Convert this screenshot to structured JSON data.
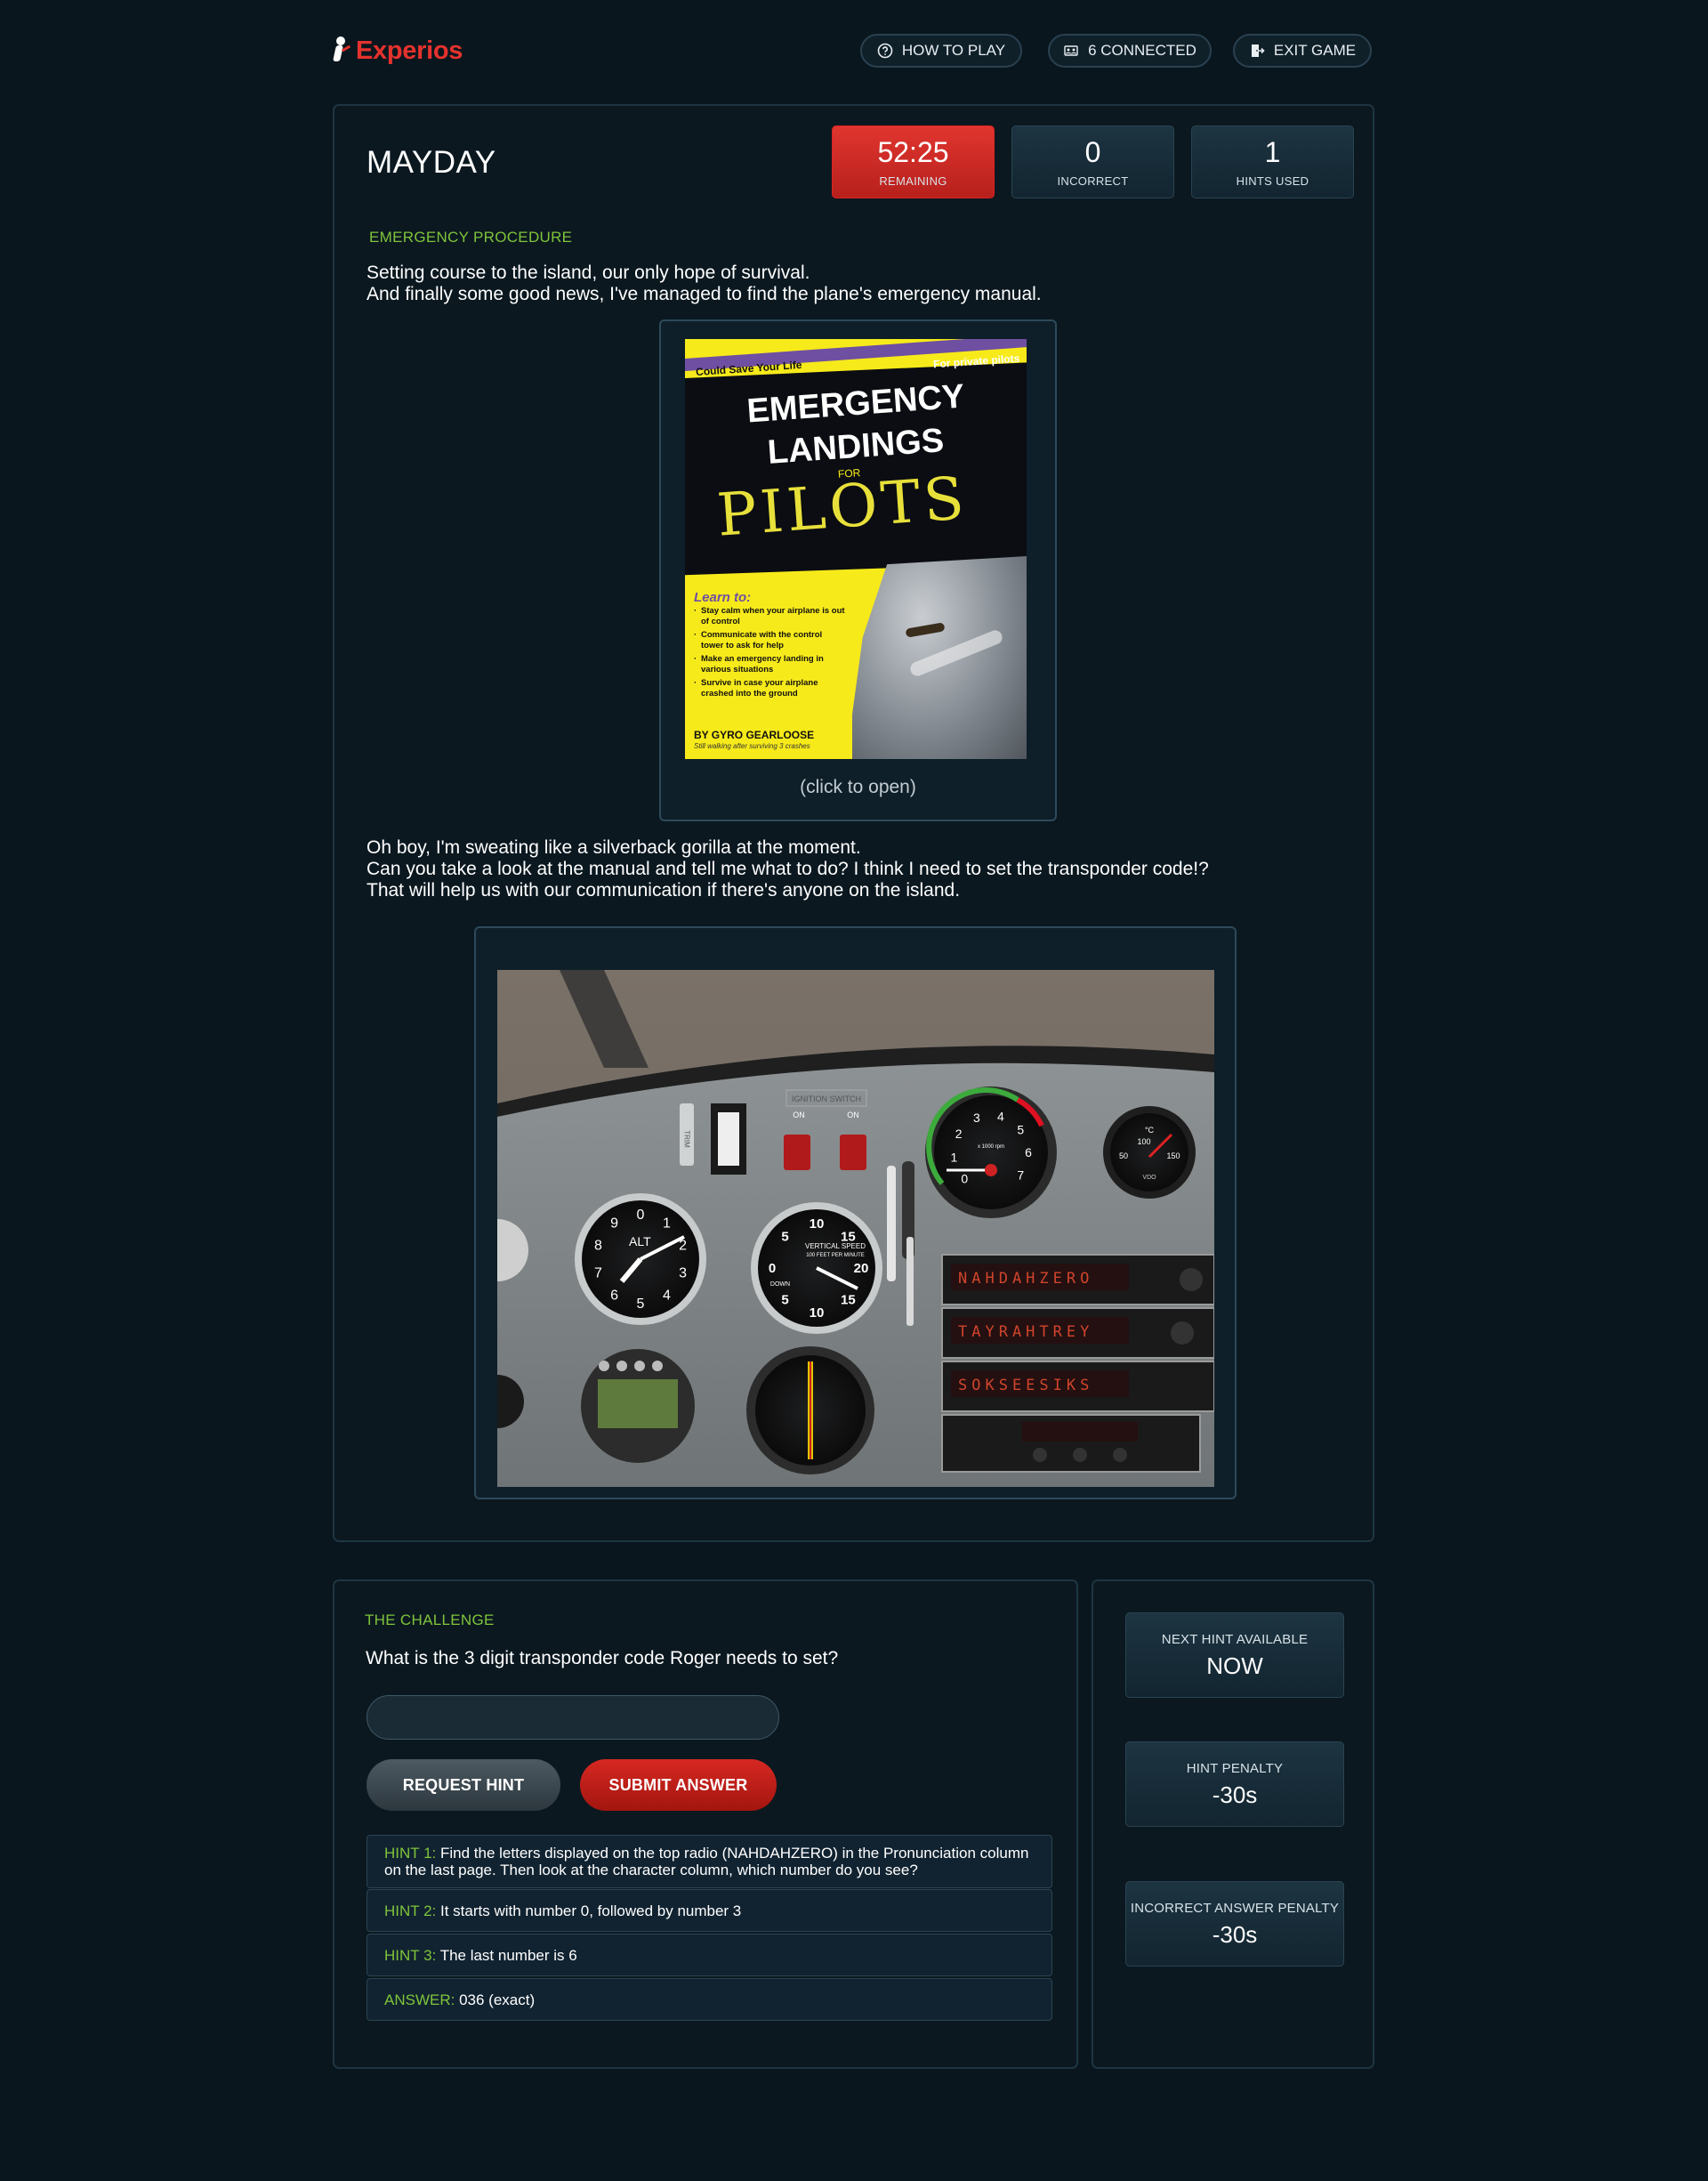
{
  "nav": {
    "brand": "Experios",
    "how_to_play": "HOW TO PLAY",
    "connected": "6 CONNECTED",
    "exit": "EXIT GAME"
  },
  "game": {
    "title": "MAYDAY",
    "stats": [
      {
        "value": "52:25",
        "label": "REMAINING"
      },
      {
        "value": "0",
        "label": "INCORRECT"
      },
      {
        "value": "1",
        "label": "HINTS USED"
      }
    ]
  },
  "story": {
    "section": "EMERGENCY PROCEDURE",
    "intro": [
      "Setting course to the island, our only hope of survival.",
      "And finally some good news, I've managed to find the plane's emergency manual."
    ],
    "click_to_open": "(click to open)",
    "body": [
      "Oh boy, I'm sweating like a silverback gorilla at the moment.",
      "Can you take a look at the manual and tell me what to do? I think I need to set the transponder code!?",
      "That will help us with our communication if there's anyone on the island."
    ]
  },
  "book": {
    "tagline": "Could Save Your Life",
    "audience": "For private pilots",
    "title_1": "EMERGENCY",
    "title_2": "LANDINGS",
    "for": "FOR",
    "title_3": "PILOTS",
    "learn": "Learn to:",
    "items": [
      "Stay calm when your airplane is out of control",
      "Communicate with the control tower to ask for help",
      "Make an emergency landing in various situations",
      "Survive in case your airplane crashed into the ground"
    ],
    "author": "BY GYRO GEARLOOSE",
    "author_note": "Still walking after surviving 3 crashes"
  },
  "cockpit": {
    "radio_1": "NAHDAHZERO",
    "radio_2": "TAYRAHTREY",
    "radio_3": "SOKSEESIKS",
    "ignition": "IGNITION SWITCH",
    "on_1": "ON",
    "on_2": "ON",
    "alt": "ALT",
    "vs_line1": "VERTICAL SPEED",
    "vs_line2": "100 FEET PER MINUTE",
    "vs_down": "DOWN",
    "rpm": "x 1000 rpm",
    "temp_unit": "°C",
    "oil_label": "VDO",
    "oil_left": "50",
    "oil_top": "100",
    "oil_right": "150",
    "trim": "TRIM",
    "alt_digits": [
      "0",
      "1",
      "2",
      "3",
      "4",
      "5",
      "6",
      "7",
      "8",
      "9"
    ],
    "vs_digits": [
      "0",
      "5",
      "10",
      "15",
      "20",
      "15",
      "10",
      "5"
    ],
    "rpm_digits": [
      "0",
      "1",
      "2",
      "3",
      "4",
      "5",
      "6",
      "7"
    ]
  },
  "challenge": {
    "section": "THE CHALLENGE",
    "question": "What is the 3 digit transponder code Roger needs to set?",
    "input_value": "",
    "input_placeholder": "",
    "request_hint": "REQUEST HINT",
    "submit": "SUBMIT ANSWER",
    "hints": [
      {
        "key": "HINT 1:",
        "text": "Find the letters displayed on the top radio (NAHDAHZERO) in the Pronunciation column on the last page. Then look at the character column, which number do you see?"
      },
      {
        "key": "HINT 2:",
        "text": "It starts with number 0, followed by number 3"
      },
      {
        "key": "HINT 3:",
        "text": "The last number is 6"
      },
      {
        "key": "ANSWER:",
        "text": "036 (exact)"
      }
    ]
  },
  "side": {
    "next_hint_label": "NEXT HINT AVAILABLE",
    "next_hint_value": "NOW",
    "hint_penalty_label": "HINT PENALTY",
    "hint_penalty_value": "-30s",
    "incorrect_penalty_label": "INCORRECT ANSWER PENALTY",
    "incorrect_penalty_value": "-30s"
  },
  "colors": {
    "accent_red": "#e5322d",
    "accent_green": "#7fc43a",
    "background": "#0a161e"
  }
}
